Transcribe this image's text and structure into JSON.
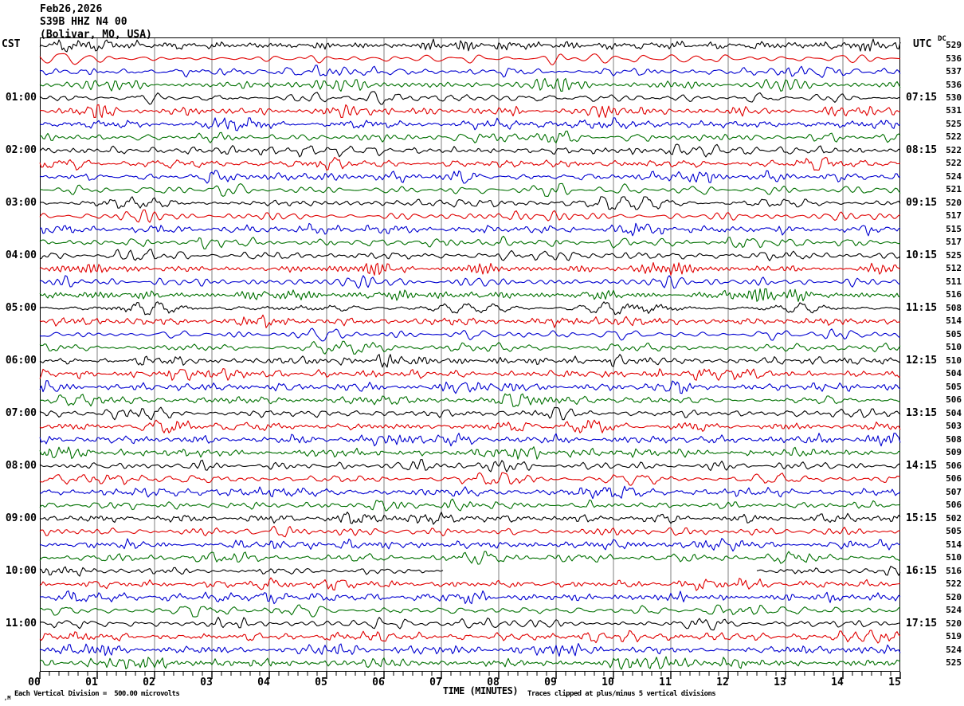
{
  "title": {
    "date": "Feb26,2026",
    "station": "S39B HHZ N4 00",
    "location": "(Bolivar, MO, USA)"
  },
  "axes": {
    "left_title": "CST",
    "right_title": "UTC",
    "dc_title": "DC",
    "x_title": "TIME (MINUTES)",
    "x_ticks": [
      "00",
      "01",
      "02",
      "03",
      "04",
      "05",
      "06",
      "07",
      "08",
      "09",
      "10",
      "11",
      "12",
      "13",
      "14",
      "15"
    ]
  },
  "footer": {
    "left_note": "Each Vertical Division =  500.00 microvolts",
    "right_note": "Traces clipped at plus/minus 5 vertical divisions",
    "watermark": ",M"
  },
  "colors": {
    "background": "#ffffff",
    "border": "#000000",
    "grid": "#7f7f7f",
    "text": "#000000"
  },
  "chart_data": {
    "type": "line",
    "subtype": "seismogram-helicorder",
    "x_range_minutes": [
      0,
      15
    ],
    "row_duration_minutes": 15,
    "rows_per_hour": 4,
    "num_rows": 48,
    "grid_interval_minutes": 1,
    "minor_tick_seconds": 10,
    "trace_color_cycle": [
      "#000000",
      "#e00000",
      "#0000d0",
      "#007000"
    ],
    "amplitude_note": "band-limited microseismic noise, traces clipped at plus/minus 5 vertical divisions, 500.00 microvolts per division",
    "gaps": [
      {
        "row": 41,
        "from_minute": 7.05,
        "to_minute": 12.5
      }
    ],
    "rows": [
      {
        "dc": 529
      },
      {
        "dc": 536
      },
      {
        "dc": 537
      },
      {
        "dc": 536
      },
      {
        "cst": "01:00",
        "utc": "07:15",
        "dc": 530
      },
      {
        "dc": 531
      },
      {
        "dc": 525
      },
      {
        "dc": 522
      },
      {
        "cst": "02:00",
        "utc": "08:15",
        "dc": 522
      },
      {
        "dc": 522
      },
      {
        "dc": 524
      },
      {
        "dc": 521
      },
      {
        "cst": "03:00",
        "utc": "09:15",
        "dc": 520
      },
      {
        "dc": 517
      },
      {
        "dc": 515
      },
      {
        "dc": 517
      },
      {
        "cst": "04:00",
        "utc": "10:15",
        "dc": 525
      },
      {
        "dc": 512
      },
      {
        "dc": 511
      },
      {
        "dc": 516
      },
      {
        "cst": "05:00",
        "utc": "11:15",
        "dc": 508
      },
      {
        "dc": 514
      },
      {
        "dc": 505
      },
      {
        "dc": 510
      },
      {
        "cst": "06:00",
        "utc": "12:15",
        "dc": 510
      },
      {
        "dc": 504
      },
      {
        "dc": 505
      },
      {
        "dc": 506
      },
      {
        "cst": "07:00",
        "utc": "13:15",
        "dc": 504
      },
      {
        "dc": 503
      },
      {
        "dc": 508
      },
      {
        "dc": 509
      },
      {
        "cst": "08:00",
        "utc": "14:15",
        "dc": 506
      },
      {
        "dc": 506
      },
      {
        "dc": 507
      },
      {
        "dc": 506
      },
      {
        "cst": "09:00",
        "utc": "15:15",
        "dc": 502
      },
      {
        "dc": 505
      },
      {
        "dc": 514
      },
      {
        "dc": 510
      },
      {
        "cst": "10:00",
        "utc": "16:15",
        "dc": 516
      },
      {
        "dc": 522
      },
      {
        "dc": 520
      },
      {
        "dc": 524
      },
      {
        "cst": "11:00",
        "utc": "17:15",
        "dc": 520
      },
      {
        "dc": 519
      },
      {
        "dc": 524
      },
      {
        "dc": 525
      }
    ]
  }
}
